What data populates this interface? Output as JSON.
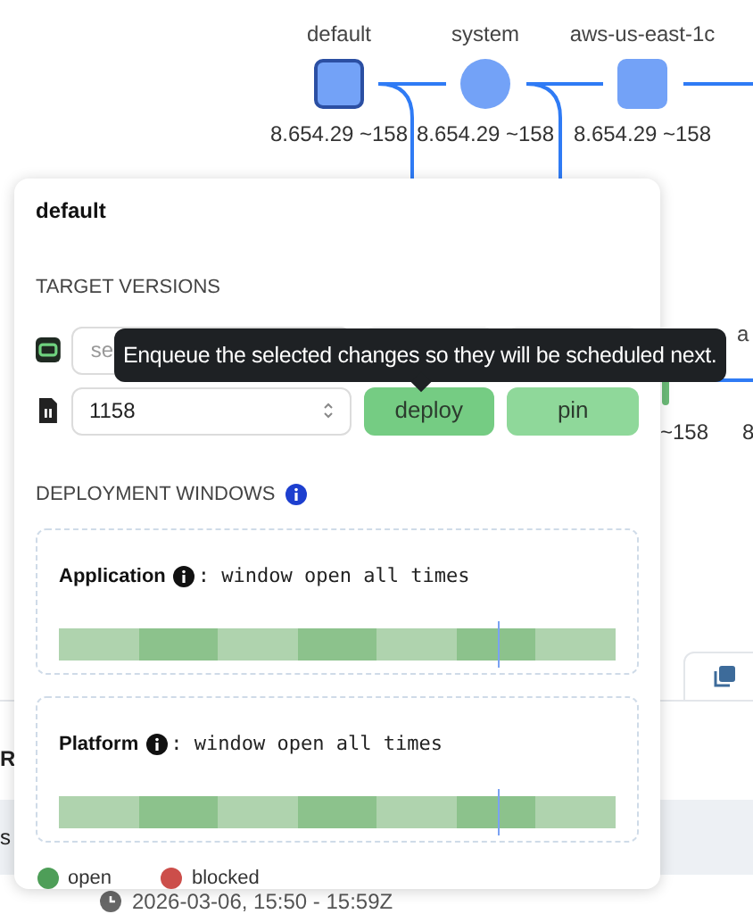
{
  "graph": {
    "nodes": [
      {
        "label": "default",
        "version": "8.654.29 ~158",
        "kind": "square",
        "selected": true
      },
      {
        "label": "system",
        "version": "8.654.29 ~158",
        "kind": "circle",
        "selected": false
      },
      {
        "label": "aws-us-east-1c",
        "version": "8.654.29 ~158",
        "kind": "square",
        "selected": false
      }
    ],
    "cut_labels": [
      "a",
      "~158",
      "8"
    ]
  },
  "background": {
    "left_fragments": [
      "R",
      "s"
    ],
    "timestamp": "2026-03-06, 15:50 - 15:59Z"
  },
  "popover": {
    "title": "default",
    "target_heading": "TARGET VERSIONS",
    "rows": [
      {
        "kind": "select",
        "placeholder": "se",
        "buttons": []
      },
      {
        "kind": "number",
        "value": "1158",
        "buttons": [
          {
            "label": "deploy",
            "primary": true
          },
          {
            "label": "pin",
            "primary": false
          }
        ]
      }
    ],
    "windows_heading": "DEPLOYMENT WINDOWS",
    "windows": [
      {
        "name": "Application",
        "status_text": ": window open all times",
        "now_marker": {
          "level": 0.79
        },
        "segments": [
          {
            "kind": "open"
          },
          {
            "kind": "open"
          },
          {
            "kind": "open"
          },
          {
            "kind": "open"
          },
          {
            "kind": "open"
          },
          {
            "kind": "open"
          },
          {
            "kind": "open"
          }
        ]
      },
      {
        "name": "Platform",
        "status_text": ": window open all times",
        "now_marker": {
          "level": 0.79
        },
        "segments": [
          {
            "kind": "open"
          },
          {
            "kind": "open"
          },
          {
            "kind": "open"
          },
          {
            "kind": "open"
          },
          {
            "kind": "open"
          },
          {
            "kind": "open"
          },
          {
            "kind": "open"
          }
        ]
      }
    ],
    "legend": [
      {
        "label": "open",
        "color": "#4e9e58"
      },
      {
        "label": "blocked",
        "color": "#cc4e4a"
      }
    ]
  },
  "tooltip": {
    "text": "Enqueue the selected changes so they will be scheduled next."
  }
}
